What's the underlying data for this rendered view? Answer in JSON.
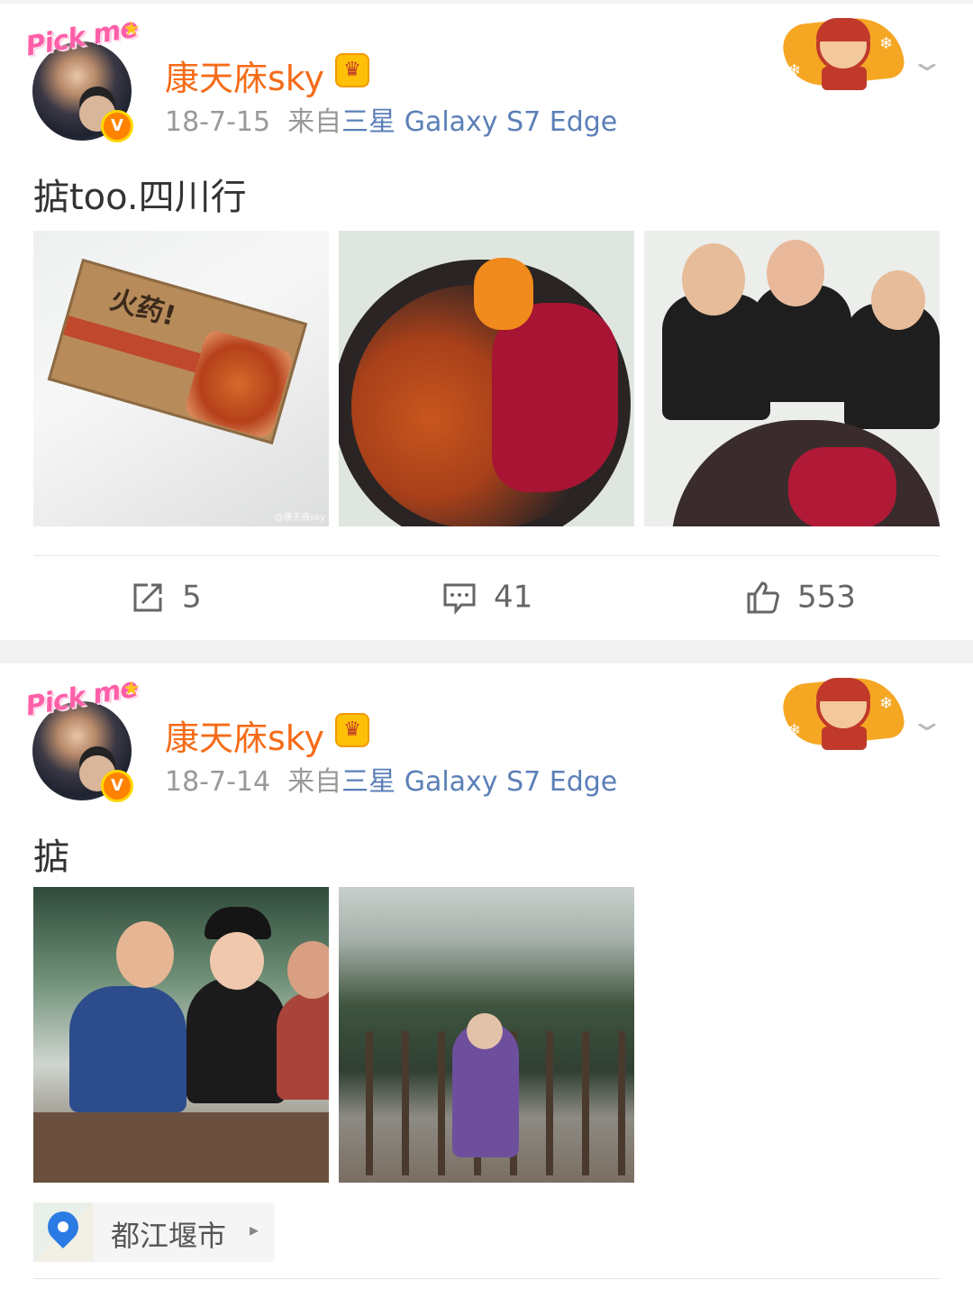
{
  "posts": [
    {
      "avatar_badge": "Pick me",
      "verified_badge": "V",
      "username": "康天庥sky",
      "date": "18-7-15",
      "from_prefix": "来自",
      "source": "三星 Galaxy S7 Edge",
      "text": "掂too.四川行",
      "photos": [
        {
          "label": "火药!",
          "watermark": "@康天庥sky"
        },
        {
          "label": ""
        },
        {
          "label": ""
        }
      ],
      "actions": {
        "reposts": "5",
        "comments": "41",
        "likes": "553"
      }
    },
    {
      "avatar_badge": "Pick me",
      "verified_badge": "V",
      "username": "康天庥sky",
      "date": "18-7-14",
      "from_prefix": "来自",
      "source": "三星 Galaxy S7 Edge",
      "text": "掂",
      "photos": [
        {
          "label": ""
        },
        {
          "label": ""
        }
      ],
      "location": "都江堰市"
    }
  ],
  "icons": {
    "repost": "repost-icon",
    "comment": "comment-icon",
    "like": "thumbs-up-icon",
    "more": "chevron-down-icon",
    "location": "location-pin-icon"
  },
  "colors": {
    "username": "#f66b17",
    "source_link": "#5b7fb8",
    "meta": "#999999",
    "verified": "#ff8200"
  }
}
